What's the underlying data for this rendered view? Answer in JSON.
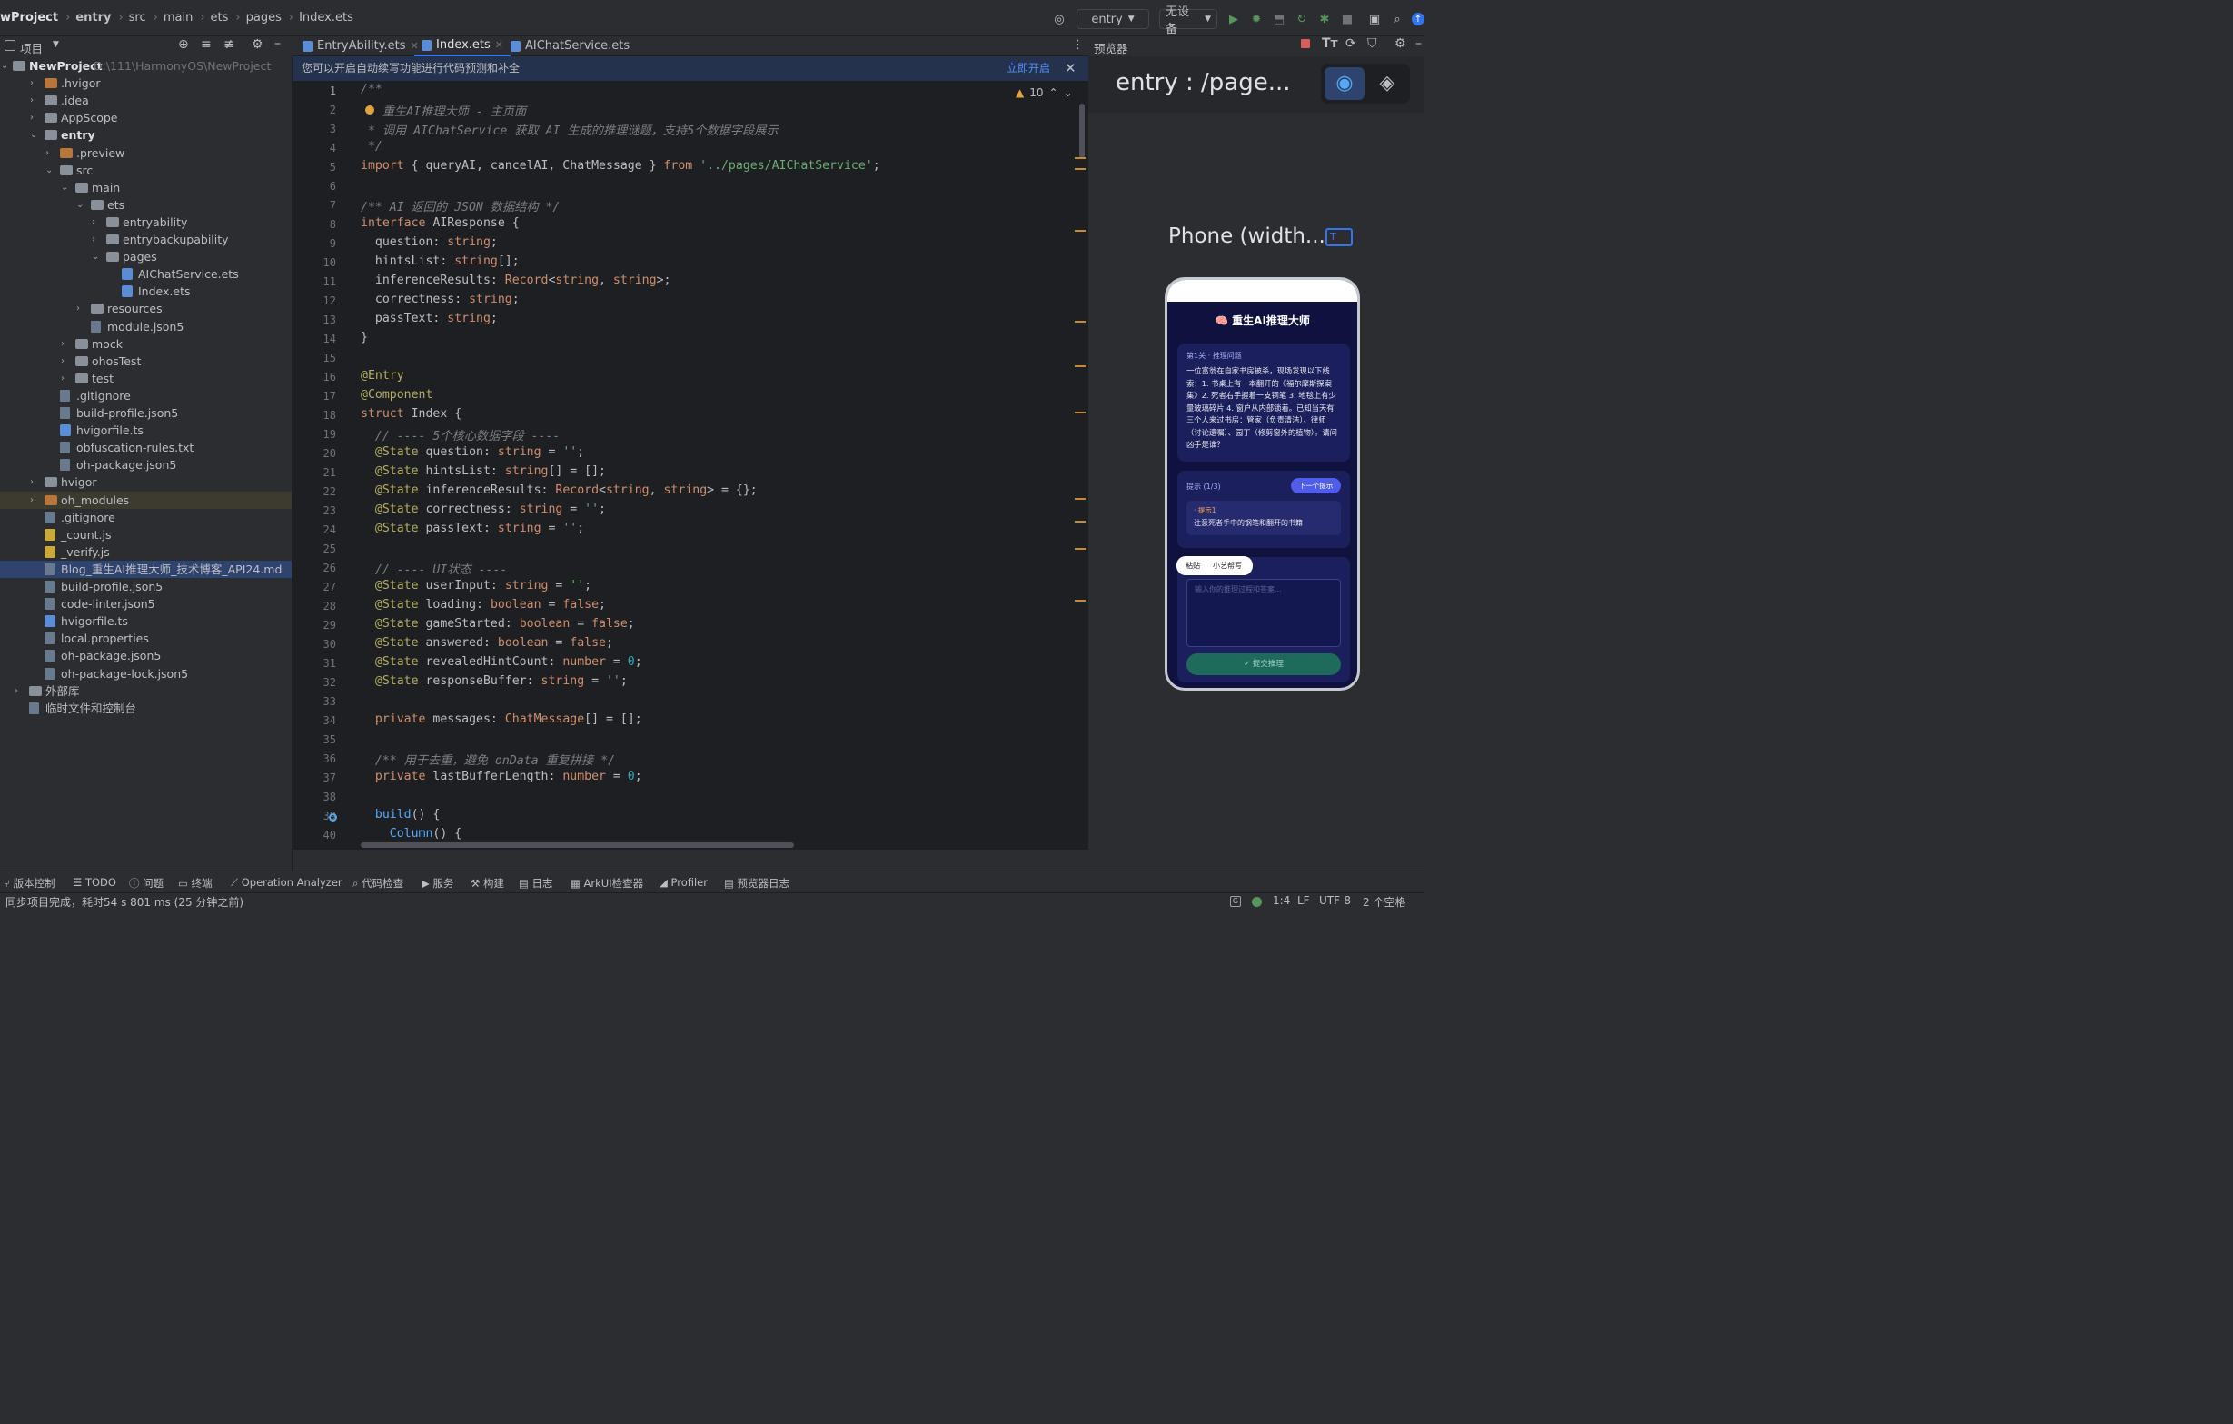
{
  "topbar": {
    "breadcrumb": [
      "wProject",
      "entry",
      "src",
      "main",
      "ets",
      "pages",
      "Index.ets"
    ],
    "run_config": "entry",
    "device": "无设备"
  },
  "project_panel": {
    "title": "项目",
    "root_name": "NewProject",
    "root_path": "D:\\111\\HarmonyOS\\NewProject",
    "items": [
      {
        "label": ".hvigor",
        "depth": 1,
        "arrow": ">",
        "kind": "folder-orange",
        "row": 1
      },
      {
        "label": ".idea",
        "depth": 1,
        "arrow": ">",
        "kind": "folder",
        "row": 2
      },
      {
        "label": "AppScope",
        "depth": 1,
        "arrow": ">",
        "kind": "folder",
        "row": 3
      },
      {
        "label": "entry",
        "depth": 1,
        "arrow": "v",
        "kind": "folder",
        "row": 4,
        "bold": true
      },
      {
        "label": ".preview",
        "depth": 2,
        "arrow": ">",
        "kind": "folder-orange",
        "row": 5
      },
      {
        "label": "src",
        "depth": 2,
        "arrow": "v",
        "kind": "folder",
        "row": 6
      },
      {
        "label": "main",
        "depth": 3,
        "arrow": "v",
        "kind": "folder",
        "row": 7
      },
      {
        "label": "ets",
        "depth": 4,
        "arrow": "v",
        "kind": "folder",
        "row": 8
      },
      {
        "label": "entryability",
        "depth": 5,
        "arrow": ">",
        "kind": "folder",
        "row": 9
      },
      {
        "label": "entrybackupability",
        "depth": 5,
        "arrow": ">",
        "kind": "folder",
        "row": 10
      },
      {
        "label": "pages",
        "depth": 5,
        "arrow": "v",
        "kind": "folder",
        "row": 11
      },
      {
        "label": "AIChatService.ets",
        "depth": 6,
        "arrow": "",
        "kind": "ets",
        "row": 12
      },
      {
        "label": "Index.ets",
        "depth": 6,
        "arrow": "",
        "kind": "ets",
        "row": 13
      },
      {
        "label": "resources",
        "depth": 4,
        "arrow": ">",
        "kind": "folder",
        "row": 14
      },
      {
        "label": "module.json5",
        "depth": 4,
        "arrow": "",
        "kind": "file",
        "row": 15
      },
      {
        "label": "mock",
        "depth": 3,
        "arrow": ">",
        "kind": "folder",
        "row": 16
      },
      {
        "label": "ohosTest",
        "depth": 3,
        "arrow": ">",
        "kind": "folder",
        "row": 17
      },
      {
        "label": "test",
        "depth": 3,
        "arrow": ">",
        "kind": "folder",
        "row": 18
      },
      {
        "label": ".gitignore",
        "depth": 2,
        "arrow": "",
        "kind": "file",
        "row": 19
      },
      {
        "label": "build-profile.json5",
        "depth": 2,
        "arrow": "",
        "kind": "file",
        "row": 20
      },
      {
        "label": "hvigorfile.ts",
        "depth": 2,
        "arrow": "",
        "kind": "ets",
        "row": 21
      },
      {
        "label": "obfuscation-rules.txt",
        "depth": 2,
        "arrow": "",
        "kind": "file",
        "row": 22
      },
      {
        "label": "oh-package.json5",
        "depth": 2,
        "arrow": "",
        "kind": "file",
        "row": 23
      },
      {
        "label": "hvigor",
        "depth": 1,
        "arrow": ">",
        "kind": "folder",
        "row": 24
      },
      {
        "label": "oh_modules",
        "depth": 1,
        "arrow": ">",
        "kind": "folder-orange",
        "row": 25,
        "hl": true
      },
      {
        "label": ".gitignore",
        "depth": 1,
        "arrow": "",
        "kind": "file",
        "row": 26
      },
      {
        "label": "_count.js",
        "depth": 1,
        "arrow": "",
        "kind": "js",
        "row": 27
      },
      {
        "label": "_verify.js",
        "depth": 1,
        "arrow": "",
        "kind": "js",
        "row": 28
      },
      {
        "label": "Blog_重生AI推理大师_技术博客_API24.md",
        "depth": 1,
        "arrow": "",
        "kind": "file",
        "row": 29,
        "sel": true
      },
      {
        "label": "build-profile.json5",
        "depth": 1,
        "arrow": "",
        "kind": "file",
        "row": 30
      },
      {
        "label": "code-linter.json5",
        "depth": 1,
        "arrow": "",
        "kind": "file",
        "row": 31
      },
      {
        "label": "hvigorfile.ts",
        "depth": 1,
        "arrow": "",
        "kind": "ets",
        "row": 32
      },
      {
        "label": "local.properties",
        "depth": 1,
        "arrow": "",
        "kind": "file",
        "row": 33
      },
      {
        "label": "oh-package.json5",
        "depth": 1,
        "arrow": "",
        "kind": "file",
        "row": 34
      },
      {
        "label": "oh-package-lock.json5",
        "depth": 1,
        "arrow": "",
        "kind": "file",
        "row": 35
      },
      {
        "label": "外部库",
        "depth": 0,
        "arrow": ">",
        "kind": "lib",
        "row": 36
      },
      {
        "label": "临时文件和控制台",
        "depth": 0,
        "arrow": "",
        "kind": "scratch",
        "row": 37
      }
    ]
  },
  "tabs": [
    {
      "label": "EntryAbility.ets",
      "active": false
    },
    {
      "label": "Index.ets",
      "active": true
    },
    {
      "label": "AIChatService.ets",
      "active": false
    }
  ],
  "banner": {
    "text": "您可以开启自动续写功能进行代码预测和补全",
    "action": "立即开启"
  },
  "editor": {
    "warning_count": "10",
    "lines": [
      [
        [
          "c",
          "/**"
        ]
      ],
      [
        [
          "c",
          " * 重生AI推理大师 - 主页面"
        ]
      ],
      [
        [
          "c",
          " * 调用 AIChatService 获取 AI 生成的推理谜题，支持5个数据字段展示"
        ]
      ],
      [
        [
          "c",
          " */"
        ]
      ],
      [
        [
          "k",
          "import"
        ],
        [
          "cls",
          " { queryAI, cancelAI, ChatMessage } "
        ],
        [
          "k",
          "from"
        ],
        [
          "s",
          " '../pages/AIChatService'"
        ],
        [
          "cls",
          ";"
        ]
      ],
      [],
      [
        [
          "c",
          "/** AI 返回的 JSON 数据结构 */"
        ]
      ],
      [
        [
          "k",
          "interface"
        ],
        [
          "cls",
          " AIResponse {"
        ]
      ],
      [
        [
          "cls",
          "  question: "
        ],
        [
          "k",
          "string"
        ],
        [
          "cls",
          ";"
        ]
      ],
      [
        [
          "cls",
          "  hintsList: "
        ],
        [
          "k",
          "string"
        ],
        [
          "cls",
          "[];"
        ]
      ],
      [
        [
          "cls",
          "  inferenceResults: "
        ],
        [
          "k",
          "Record"
        ],
        [
          "cls",
          "<"
        ],
        [
          "k",
          "string"
        ],
        [
          "cls",
          ", "
        ],
        [
          "k",
          "string"
        ],
        [
          "cls",
          ">;"
        ]
      ],
      [
        [
          "cls",
          "  correctness: "
        ],
        [
          "k",
          "string"
        ],
        [
          "cls",
          ";"
        ]
      ],
      [
        [
          "cls",
          "  passText: "
        ],
        [
          "k",
          "string"
        ],
        [
          "cls",
          ";"
        ]
      ],
      [
        [
          "cls",
          "}"
        ]
      ],
      [],
      [
        [
          "a",
          "@Entry"
        ]
      ],
      [
        [
          "a",
          "@Component"
        ]
      ],
      [
        [
          "k",
          "struct"
        ],
        [
          "cls",
          " Index {"
        ]
      ],
      [
        [
          "c",
          "  // ---- 5个核心数据字段 ----"
        ]
      ],
      [
        [
          "a",
          "  @State"
        ],
        [
          "cls",
          " question: "
        ],
        [
          "k",
          "string"
        ],
        [
          "cls",
          " = "
        ],
        [
          "s",
          "''"
        ],
        [
          "cls",
          ";"
        ]
      ],
      [
        [
          "a",
          "  @State"
        ],
        [
          "cls",
          " hintsList: "
        ],
        [
          "k",
          "string"
        ],
        [
          "cls",
          "[] = [];"
        ]
      ],
      [
        [
          "a",
          "  @State"
        ],
        [
          "cls",
          " inferenceResults: "
        ],
        [
          "k",
          "Record"
        ],
        [
          "cls",
          "<"
        ],
        [
          "k",
          "string"
        ],
        [
          "cls",
          ", "
        ],
        [
          "k",
          "string"
        ],
        [
          "cls",
          "> = {};"
        ]
      ],
      [
        [
          "a",
          "  @State"
        ],
        [
          "cls",
          " correctness: "
        ],
        [
          "k",
          "string"
        ],
        [
          "cls",
          " = "
        ],
        [
          "s",
          "''"
        ],
        [
          "cls",
          ";"
        ]
      ],
      [
        [
          "a",
          "  @State"
        ],
        [
          "cls",
          " passText: "
        ],
        [
          "k",
          "string"
        ],
        [
          "cls",
          " = "
        ],
        [
          "s",
          "''"
        ],
        [
          "cls",
          ";"
        ]
      ],
      [],
      [
        [
          "c",
          "  // ---- UI状态 ----"
        ]
      ],
      [
        [
          "a",
          "  @State"
        ],
        [
          "cls",
          " userInput: "
        ],
        [
          "k",
          "string"
        ],
        [
          "cls",
          " = "
        ],
        [
          "s",
          "''"
        ],
        [
          "cls",
          ";"
        ]
      ],
      [
        [
          "a",
          "  @State"
        ],
        [
          "cls",
          " loading: "
        ],
        [
          "k",
          "boolean"
        ],
        [
          "cls",
          " = "
        ],
        [
          "k",
          "false"
        ],
        [
          "cls",
          ";"
        ]
      ],
      [
        [
          "a",
          "  @State"
        ],
        [
          "cls",
          " gameStarted: "
        ],
        [
          "k",
          "boolean"
        ],
        [
          "cls",
          " = "
        ],
        [
          "k",
          "false"
        ],
        [
          "cls",
          ";"
        ]
      ],
      [
        [
          "a",
          "  @State"
        ],
        [
          "cls",
          " answered: "
        ],
        [
          "k",
          "boolean"
        ],
        [
          "cls",
          " = "
        ],
        [
          "k",
          "false"
        ],
        [
          "cls",
          ";"
        ]
      ],
      [
        [
          "a",
          "  @State"
        ],
        [
          "cls",
          " revealedHintCount: "
        ],
        [
          "k",
          "number"
        ],
        [
          "cls",
          " = "
        ],
        [
          "n",
          "0"
        ],
        [
          "cls",
          ";"
        ]
      ],
      [
        [
          "a",
          "  @State"
        ],
        [
          "cls",
          " responseBuffer: "
        ],
        [
          "k",
          "string"
        ],
        [
          "cls",
          " = "
        ],
        [
          "s",
          "''"
        ],
        [
          "cls",
          ";"
        ]
      ],
      [],
      [
        [
          "k",
          "  private"
        ],
        [
          "cls",
          " messages: "
        ],
        [
          "k",
          "ChatMessage"
        ],
        [
          "cls",
          "[] = [];"
        ]
      ],
      [],
      [
        [
          "c",
          "  /** 用于去重，避免 onData 重复拼接 */"
        ]
      ],
      [
        [
          "k",
          "  private"
        ],
        [
          "cls",
          " lastBufferLength: "
        ],
        [
          "k",
          "number"
        ],
        [
          "cls",
          " = "
        ],
        [
          "n",
          "0"
        ],
        [
          "cls",
          ";"
        ]
      ],
      [],
      [
        [
          "f",
          "  build"
        ],
        [
          "cls",
          "() {"
        ]
      ],
      [
        [
          "f",
          "    Column"
        ],
        [
          "cls",
          "() {"
        ]
      ]
    ]
  },
  "preview": {
    "title": "预览器",
    "page_label": "entry : /page...",
    "device_label": "Phone (width...",
    "phone": {
      "app_title": "🧠 重生AI推理大师",
      "card1_header": "第1关 · 推理问题",
      "card1_body": "一位富翁在自家书房被杀，现场发现以下线索：1. 书桌上有一本翻开的《福尔摩斯探案集》2. 死者右手握着一支钢笔 3. 地毯上有少量玻璃碎片 4. 窗户从内部锁着。已知当天有三个人来过书房：管家（负责清洁）、律师（讨论遗嘱）、园丁（修剪窗外的植物）。请问凶手是谁？",
      "hint_header": "提示 (1/3)",
      "next_hint": "下一个提示",
      "hint1_title": "· 提示1",
      "hint1_body": "注意死者手中的钢笔和翻开的书籍",
      "chip_paste": "粘贴",
      "chip_yiyi": "小艺帮写",
      "input_placeholder": "输入你的推理过程和答案...",
      "submit": "✓ 提交推理"
    }
  },
  "bottom_tools": [
    "版本控制",
    "TODO",
    "问题",
    "终端",
    "Operation Analyzer",
    "代码检查",
    "服务",
    "构建",
    "日志",
    "ArkUI检查器",
    "Profiler",
    "预览器日志"
  ],
  "status": {
    "message": "同步项目完成，耗时54 s 801 ms (25 分钟之前)",
    "position": "1:4",
    "line_sep": "LF",
    "encoding": "UTF-8",
    "indent": "2 个空格"
  }
}
